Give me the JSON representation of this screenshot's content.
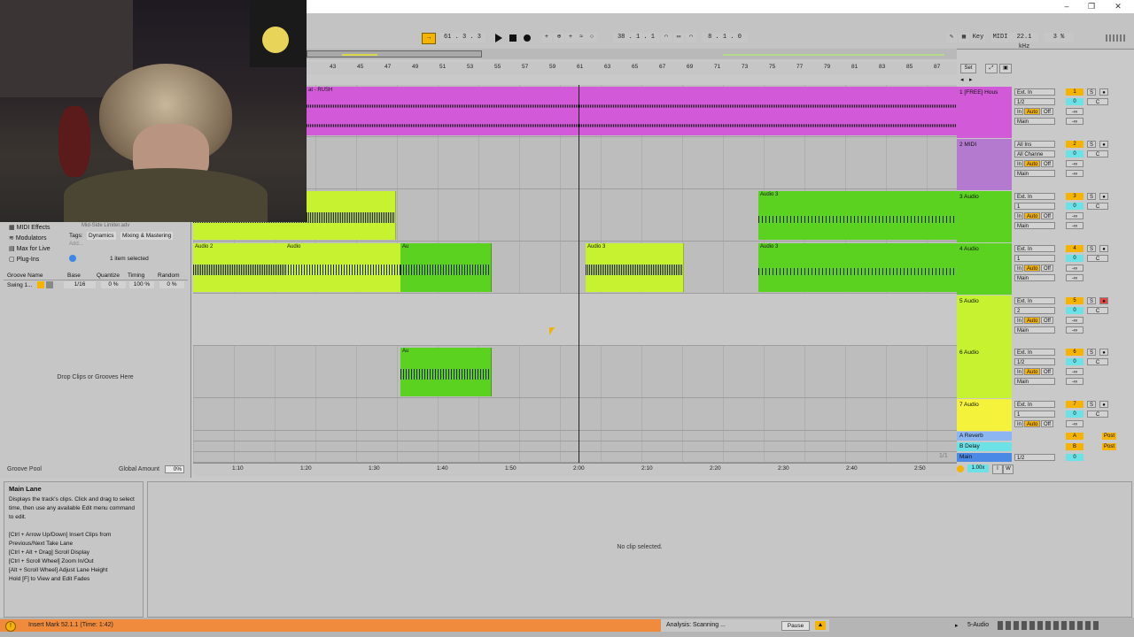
{
  "window": {
    "minimize": "–",
    "restore": "❐",
    "close": "✕"
  },
  "transport": {
    "position": "61 .  3 .  3",
    "loop_start": "38 .  1 .  1",
    "loop_length": "8 .  1 .  0",
    "key_label": "Key",
    "midi_label": "MIDI",
    "sample_rate": "22.1 kHz",
    "cpu": "3 %"
  },
  "browser": {
    "items": [
      "MIDI Effects",
      "Modulators",
      "Max for Live",
      "Plug-Ins"
    ],
    "tags_label": "Tags:",
    "tags": [
      "Dynamics",
      "Mixing & Mastering"
    ],
    "partial_text": "Mid-Side Limiter.adv",
    "add_label": "Add...",
    "selected_count": "1 item selected"
  },
  "groove": {
    "headers": [
      "Groove Name",
      "Base",
      "Quantize",
      "Timing",
      "Random"
    ],
    "row": {
      "name": "Swing 1...",
      "base": "1/16",
      "quantize": "0 %",
      "timing": "100 %",
      "random": "0 %"
    },
    "drop_text": "Drop Clips or Grooves Here",
    "pool_label": "Groove Pool",
    "global_amount_label": "Global Amount",
    "global_amount": "0%"
  },
  "ruler": {
    "bars": [
      "43",
      "45",
      "47",
      "49",
      "51",
      "53",
      "55",
      "57",
      "59",
      "61",
      "63",
      "65",
      "67",
      "69",
      "71",
      "73",
      "75",
      "77",
      "79",
      "81",
      "83",
      "85",
      "87"
    ],
    "set_label": "Set"
  },
  "time_ruler": [
    "1:10",
    "1:20",
    "1:30",
    "1:40",
    "1:50",
    "2:00",
    "2:10",
    "2:20",
    "2:30",
    "2:40",
    "2:50"
  ],
  "clips": {
    "track1": "at - RUSH",
    "audio2": "Audio 2",
    "audio3": "Audio 3",
    "audio_short": "Audio",
    "a": "A",
    "au": "Au"
  },
  "tracks": [
    {
      "name": "1 [FREE] Hous",
      "color": "#d25ad9",
      "input": "Ext. In",
      "channel": "1/2",
      "number": "1",
      "out": "Main"
    },
    {
      "name": "2 MIDI",
      "color": "#b47ad0",
      "input": "All Ins",
      "channel": "All Channe",
      "number": "2",
      "out": "Main"
    },
    {
      "name": "3 Audio",
      "color": "#5bd21f",
      "input": "Ext. In",
      "channel": "1",
      "number": "3",
      "out": "Main"
    },
    {
      "name": "4 Audio",
      "color": "#5bd21f",
      "input": "Ext. In",
      "channel": "1",
      "number": "4",
      "out": "Main"
    },
    {
      "name": "5 Audio",
      "color": "#c7f230",
      "input": "Ext. In",
      "channel": "2",
      "number": "5",
      "out": "Main"
    },
    {
      "name": "6 Audio",
      "color": "#c7f230",
      "input": "Ext. In",
      "channel": "1/2",
      "number": "6",
      "out": "Main"
    },
    {
      "name": "7 Audio",
      "color": "#f4f23a",
      "input": "Ext. In",
      "channel": "1",
      "number": "7",
      "out": "Main"
    }
  ],
  "returns": [
    {
      "name": "A Reverb",
      "letter": "A",
      "color": "#8bb6f2"
    },
    {
      "name": "B Delay",
      "letter": "B",
      "color": "#6ce1e6"
    },
    {
      "name": "Main",
      "letter": "",
      "color": "#4a8ae6"
    }
  ],
  "mixer_labels": {
    "in": "In",
    "auto": "Auto",
    "off": "Off",
    "solo": "S",
    "zero": "0",
    "c": "C",
    "neg_inf": "-∞",
    "post": "Post",
    "main_ratio": "1/2",
    "page": "1/1"
  },
  "info": {
    "title": "Main Lane",
    "text": "Displays the track's clips. Click and drag to select time, then use any available Edit menu command to edit.",
    "shortcuts": [
      "[Ctrl + Arrow Up/Down] Insert Clips from Previous/Next Take Lane",
      "[Ctrl + Alt + Drag] Scroll Display",
      "[Ctrl + Scroll Wheel] Zoom In/Out",
      "[Alt + Scroll Wheel] Adjust Lane Height",
      "Hold [F] to View and Edit Fades"
    ]
  },
  "detail_text": "No clip selected.",
  "status": {
    "message": "Insert Mark 52.1.1 (Time: 1:42)",
    "analysis": "Analysis: Scanning ...",
    "pause": "Pause",
    "track": "5-Audio"
  },
  "zoom": "1.00x",
  "colors": {
    "magenta": "#d25ad9",
    "green": "#5bd21f",
    "lime": "#c7f230",
    "yellow": "#f4f23a",
    "orange": "#f08a3c",
    "follow": "#f5b400"
  }
}
